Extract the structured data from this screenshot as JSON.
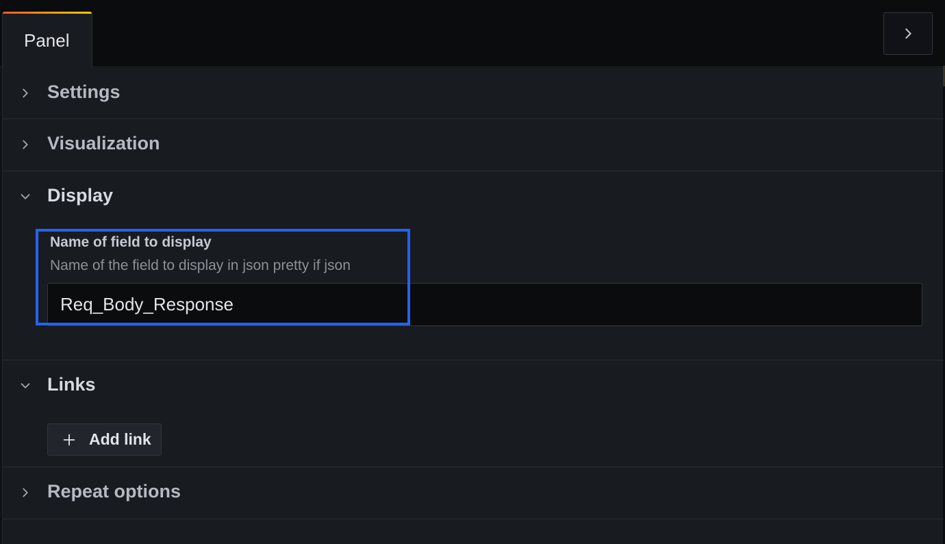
{
  "panel_tab": {
    "label": "Panel"
  },
  "header": {
    "collapse_icon": "chevron-right-icon"
  },
  "sections": [
    {
      "title": "Settings",
      "state": "collapsed",
      "icon": "chevron-right-icon"
    },
    {
      "title": "Visualization",
      "state": "collapsed",
      "icon": "chevron-right-icon"
    },
    {
      "title": "Display",
      "state": "expanded",
      "icon": "chevron-down-icon"
    },
    {
      "title": "Links",
      "state": "expanded",
      "icon": "chevron-down-icon"
    },
    {
      "title": "Repeat options",
      "state": "collapsed",
      "icon": "chevron-right-icon"
    }
  ],
  "display": {
    "field_label": "Name of field to display",
    "field_description": "Name of the field to display in json pretty if json",
    "field_value": "Req_Body_Response"
  },
  "links": {
    "add_link_label": "Add link",
    "add_icon": "plus-icon"
  },
  "colors": {
    "background": "#111217",
    "panel": "#181b1f",
    "highlight": "#2463f2",
    "tab_accent_start": "#f05a28",
    "tab_accent_end": "#fbca0a"
  }
}
